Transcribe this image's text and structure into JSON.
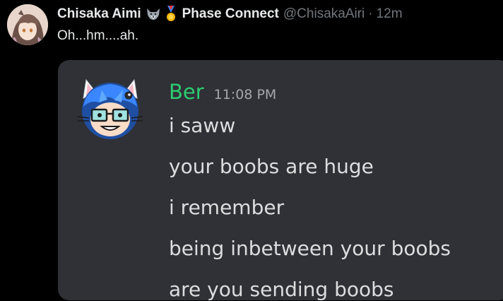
{
  "tweet": {
    "display_name": "Chisaka Aimi",
    "badge_icons": [
      "wolf-emoji-icon",
      "medal-icon"
    ],
    "affiliation": "Phase Connect",
    "handle": "@ChisakaAiri",
    "separator": "·",
    "time": "12m",
    "text": "Oh...hm....ah."
  },
  "embedded_image": {
    "username": "Ber",
    "username_color": "#2ecc71",
    "time": "11:08 PM",
    "messages": [
      "i saww",
      "your boobs are huge",
      "i remember",
      "being inbetween your boobs",
      "are you sending boobs"
    ]
  }
}
